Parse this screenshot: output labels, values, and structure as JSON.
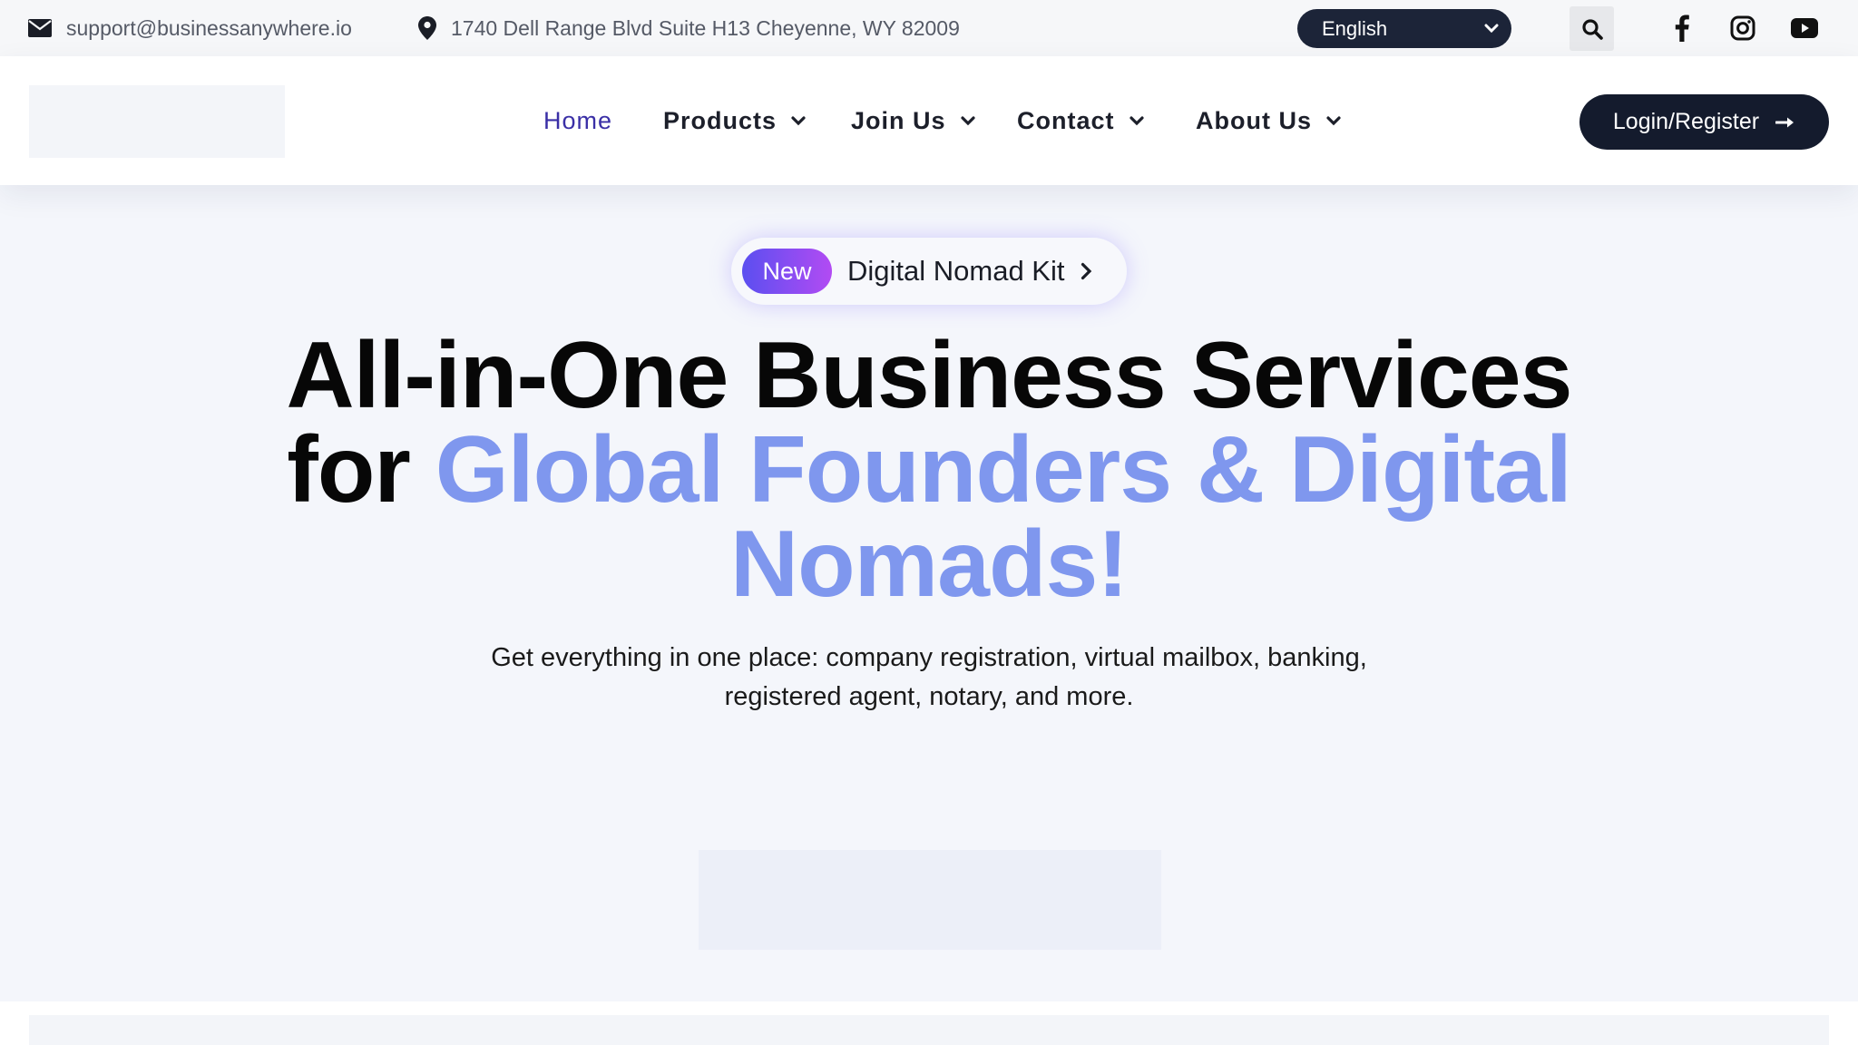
{
  "topbar": {
    "email": "support@businessanywhere.io",
    "address": "1740 Dell Range Blvd Suite H13 Cheyenne, WY 82009",
    "language": {
      "selected": "English"
    },
    "icons": {
      "email": "envelope-icon",
      "address": "map-pin-icon",
      "search": "search-icon"
    },
    "social": [
      "facebook-icon",
      "instagram-icon",
      "youtube-icon"
    ]
  },
  "nav": {
    "items": [
      {
        "label": "Home",
        "active": true,
        "dropdown": false
      },
      {
        "label": "Products",
        "active": false,
        "dropdown": true
      },
      {
        "label": "Join Us",
        "active": false,
        "dropdown": true
      },
      {
        "label": "Contact",
        "active": false,
        "dropdown": true
      },
      {
        "label": "About Us",
        "active": false,
        "dropdown": true
      }
    ],
    "login_label": "Login/Register"
  },
  "hero": {
    "badge": "New",
    "pill_label": "Digital Nomad Kit",
    "headline_plain_1": "All-in-One Business Services",
    "headline_plain_2": "for ",
    "headline_accent": "Global Founders & Digital Nomads!",
    "subtitle": "Get everything in one place: company registration, virtual mailbox, banking, registered agent, notary, and more."
  },
  "colors": {
    "accent": "#7f97ee",
    "nav_active": "#3a2fa6",
    "dark": "#141b2d",
    "badge_gradient": [
      "#5b4ff0",
      "#b24bf3"
    ]
  }
}
